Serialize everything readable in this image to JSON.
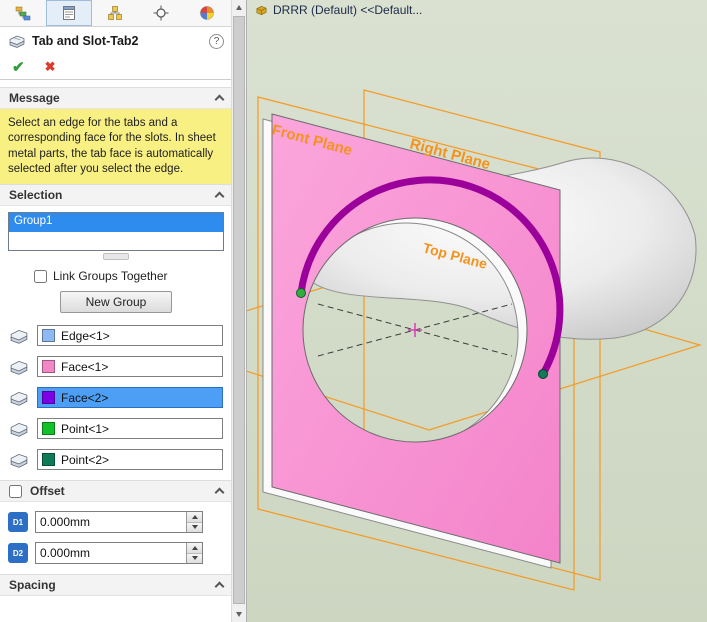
{
  "panel": {
    "tabs": [
      {
        "icon": "featuremanager-tree-icon"
      },
      {
        "icon": "propertymanager-icon",
        "active": true
      },
      {
        "icon": "configurationmanager-icon"
      },
      {
        "icon": "dimxpert-icon"
      },
      {
        "icon": "displaymanager-icon"
      }
    ],
    "title": "Tab and Slot-Tab2",
    "help_label": "?",
    "ok_label": "✔",
    "cancel_label": "✖",
    "sections": {
      "message": "Message",
      "selection": "Selection",
      "offset": "Offset",
      "spacing": "Spacing"
    },
    "message_text": "Select an edge for the tabs and a corresponding face for the slots. In sheet metal parts, the tab face is automatically selected after you select the edge.",
    "selection": {
      "group_name": "Group1",
      "link_groups_label": "Link Groups Together",
      "new_group_label": "New Group",
      "fields": [
        {
          "label": "Edge<1>",
          "color": "#8FB9F2"
        },
        {
          "label": "Face<1>",
          "color": "#F287C6"
        },
        {
          "label": "Face<2>",
          "color": "#7C00E6"
        },
        {
          "label": "Point<1>",
          "color": "#12C02A"
        },
        {
          "label": "Point<2>",
          "color": "#0E7A58"
        }
      ]
    },
    "offset": {
      "d1_label": "D1",
      "d2_label": "D2",
      "d1_value": "0.000mm",
      "d2_value": "0.000mm"
    }
  },
  "viewport": {
    "config_label": "DRRR (Default) <<Default...",
    "planes": {
      "front": "Front Plane",
      "right": "Right Plane",
      "top": "Top Plane"
    },
    "colors": {
      "plane_orange": "#F59A23",
      "plate_pink": "#F78FD0",
      "arc_purple": "#9B009B",
      "background": "#D2DCC8"
    }
  }
}
